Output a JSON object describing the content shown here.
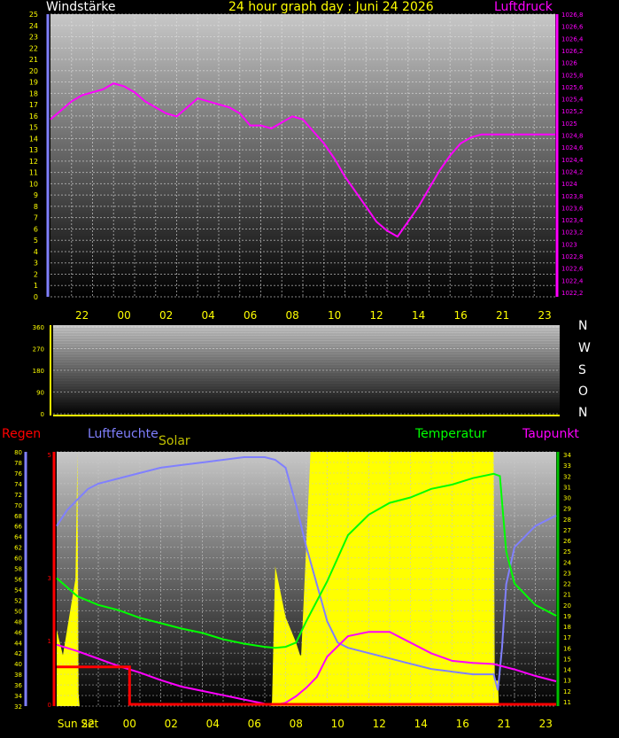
{
  "header": {
    "left_title": "Windstärke",
    "center_title": "24 hour graph day : Juni 24 2026",
    "right_title": "Luftdruck"
  },
  "wind_dir_letters": [
    "N",
    "W",
    "S",
    "O",
    "N"
  ],
  "bottom_headers": {
    "regen": "Regen",
    "luftfeuchte": "Luftfeuchte",
    "solar": "Solar",
    "temperatur": "Temperatur",
    "taupunkt": "Taupunkt"
  },
  "sun_label": "Sun Set",
  "colors": {
    "pressure": "#ff00ff",
    "humidity": "#8080ff",
    "temperature": "#00ff00",
    "dewpoint": "#ff00ff",
    "rain": "#ff0000",
    "solar": "#ffff00",
    "axis_labels": "#ffff00",
    "title": "#ffff00"
  },
  "chart_data": [
    {
      "type": "line",
      "name": "top-panel",
      "x_ticks": [
        "22",
        "00",
        "02",
        "04",
        "06",
        "08",
        "10",
        "12",
        "14",
        "16",
        "21",
        "23"
      ],
      "left_axis": {
        "label": "Windstärke",
        "range": [
          0,
          25
        ],
        "ticks": [
          0,
          1,
          2,
          3,
          4,
          5,
          6,
          7,
          8,
          9,
          10,
          11,
          12,
          13,
          14,
          15,
          16,
          17,
          18,
          19,
          20,
          21,
          22,
          23,
          24,
          25
        ]
      },
      "right_axis": {
        "label": "Luftdruck",
        "range": [
          1022.2,
          1025.8
        ],
        "ticks": [
          "1022,2",
          "1022,4",
          "1022,6",
          "1022,8",
          "1023",
          "1023,2",
          "1023,4",
          "1023,6",
          "1023,8",
          "1024",
          "1024,2",
          "1024,4",
          "1024,6",
          "1024,8",
          "1025",
          "1025,2",
          "1025,4",
          "1025,6",
          "1025,8",
          "1026",
          "1026,2",
          "1026,4",
          "1026,6",
          "1026,8"
        ]
      },
      "series": [
        {
          "name": "Luftdruck",
          "axis": "right",
          "x": [
            0,
            0.5,
            1,
            1.5,
            2,
            2.5,
            3,
            3.5,
            4,
            4.5,
            5,
            5.5,
            6,
            6.5,
            7,
            7.5,
            8,
            8.5,
            9,
            9.5,
            10,
            10.5,
            11,
            11.5,
            12,
            12.5,
            13,
            13.5,
            14,
            14.5,
            15,
            15.5,
            16,
            16.5,
            17,
            17.5,
            18,
            18.5,
            19,
            19.5,
            20,
            20.5,
            21,
            21.5,
            22,
            22.5,
            23,
            23.5,
            24
          ],
          "values": [
            1025.15,
            1025.3,
            1025.45,
            1025.55,
            1025.6,
            1025.65,
            1025.75,
            1025.7,
            1025.6,
            1025.45,
            1025.35,
            1025.25,
            1025.2,
            1025.35,
            1025.5,
            1025.45,
            1025.4,
            1025.35,
            1025.25,
            1025.05,
            1025.05,
            1025.0,
            1025.1,
            1025.2,
            1025.15,
            1024.95,
            1024.75,
            1024.5,
            1024.2,
            1023.95,
            1023.7,
            1023.45,
            1023.3,
            1023.2,
            1023.45,
            1023.7,
            1024.0,
            1024.3,
            1024.55,
            1024.75,
            1024.85,
            1024.9,
            1024.9,
            1024.9,
            1024.9,
            1024.9,
            1024.9,
            1024.9,
            1024.9
          ]
        }
      ]
    },
    {
      "type": "line",
      "name": "wind-direction-panel",
      "y_ticks": [
        "0",
        "90",
        "180",
        "270",
        "360"
      ],
      "ylim": [
        0,
        360
      ],
      "series": []
    },
    {
      "type": "line",
      "name": "bottom-panel",
      "x_ticks": [
        "Sun Set",
        "22",
        "00",
        "02",
        "04",
        "06",
        "08",
        "10",
        "12",
        "14",
        "16",
        "21",
        "23"
      ],
      "humidity_axis": {
        "range": [
          32,
          80
        ],
        "ticks": [
          32,
          34,
          36,
          38,
          40,
          42,
          44,
          46,
          48,
          50,
          52,
          54,
          56,
          58,
          60,
          62,
          64,
          66,
          68,
          70,
          72,
          74,
          76,
          78,
          80
        ]
      },
      "rain_axis": {
        "ticks": [
          "0",
          "1",
          "3",
          "5"
        ]
      },
      "temperature_axis": {
        "range": [
          11,
          34
        ],
        "ticks": [
          11,
          12,
          13,
          14,
          15,
          16,
          17,
          18,
          19,
          20,
          21,
          22,
          23,
          24,
          25,
          26,
          27,
          28,
          29,
          30,
          31,
          32,
          33,
          34
        ]
      },
      "series": [
        {
          "name": "Luftfeuchte",
          "axis": "humidity",
          "x": [
            0,
            0.5,
            1,
            1.5,
            2,
            3,
            4,
            5,
            6,
            7,
            8,
            9,
            10,
            10.5,
            11,
            11.5,
            12,
            12.5,
            13,
            13.5,
            14,
            15,
            16,
            17,
            18,
            19,
            20,
            21,
            21.2,
            21.4,
            21.6,
            22,
            23,
            24
          ],
          "values": [
            66,
            69,
            71,
            73,
            74,
            75,
            76,
            77,
            77.5,
            78,
            78.5,
            79,
            79,
            78.5,
            77,
            70,
            62,
            55,
            48,
            44,
            43,
            42,
            41,
            40,
            39,
            38.5,
            38,
            38,
            35,
            43,
            55,
            62,
            66,
            68
          ]
        },
        {
          "name": "Temperatur",
          "axis": "temperature",
          "x": [
            0,
            1,
            2,
            3,
            4,
            5,
            6,
            7,
            8,
            9,
            10,
            10.5,
            11,
            11.5,
            12,
            13,
            14,
            15,
            16,
            17,
            18,
            19,
            20,
            21,
            21.3,
            21.6,
            22,
            23,
            24
          ],
          "values": [
            22.5,
            20.8,
            20.0,
            19.5,
            18.8,
            18.3,
            17.8,
            17.4,
            16.8,
            16.4,
            16.1,
            16.0,
            16.1,
            16.5,
            18.5,
            22.2,
            26.5,
            28.4,
            29.5,
            30.0,
            30.8,
            31.2,
            31.8,
            32.2,
            32.0,
            25,
            22,
            20,
            19
          ]
        },
        {
          "name": "Taupunkt",
          "axis": "temperature",
          "x": [
            0,
            1,
            2,
            3,
            4,
            5,
            6,
            7,
            8,
            9,
            10,
            10.5,
            11,
            11.5,
            12,
            12.5,
            13,
            14,
            15,
            16,
            17,
            18,
            19,
            20,
            21,
            22,
            23,
            24
          ],
          "values": [
            16.3,
            15.7,
            15.0,
            14.3,
            13.7,
            13.0,
            12.4,
            12.0,
            11.6,
            11.2,
            10.8,
            10.7,
            10.9,
            11.5,
            12.3,
            13.3,
            15.2,
            17.1,
            17.5,
            17.5,
            16.5,
            15.5,
            14.8,
            14.6,
            14.5,
            14.0,
            13.4,
            12.9
          ]
        },
        {
          "name": "Regen",
          "axis": "rain",
          "x": [
            0,
            3.5,
            3.5,
            24
          ],
          "values": [
            0.15,
            0.15,
            0,
            0
          ]
        },
        {
          "name": "Solar",
          "axis": "relative",
          "x": [
            0,
            0.3,
            0.6,
            0.9,
            1.0,
            1.05,
            1.1,
            10.3,
            10.35,
            10.5,
            11.0,
            11.5,
            11.7,
            11.75,
            12.2,
            13,
            14,
            15,
            17,
            19,
            20,
            21,
            21.05,
            21.2,
            21.25,
            24
          ],
          "values": [
            0.3,
            0.2,
            0.35,
            0.5,
            1.0,
            0.05,
            0,
            0,
            0.02,
            0.55,
            0.35,
            0.25,
            0.2,
            0.2,
            1.0,
            1.0,
            1.0,
            1.0,
            1.0,
            1.0,
            1.0,
            1.0,
            0.1,
            0.1,
            0,
            0
          ]
        }
      ]
    }
  ]
}
